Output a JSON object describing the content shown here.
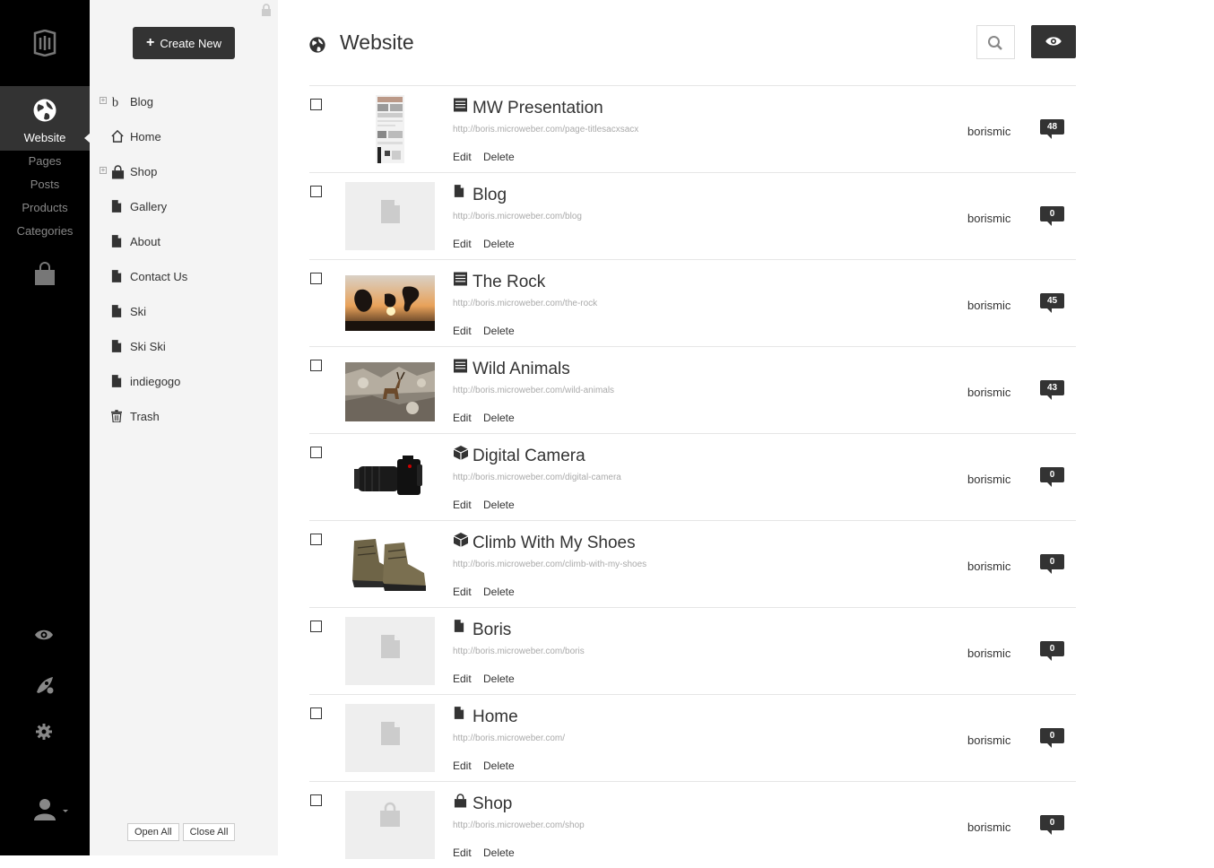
{
  "rail": {
    "active_label": "Website",
    "sub_items": [
      "Pages",
      "Posts",
      "Products",
      "Categories"
    ]
  },
  "tree": {
    "create_label": "Create New",
    "nodes": [
      {
        "label": "Blog",
        "icon": "blog-icon",
        "expandable": true
      },
      {
        "label": "Home",
        "icon": "home-icon",
        "expandable": false
      },
      {
        "label": "Shop",
        "icon": "shop-bag-icon",
        "expandable": true
      },
      {
        "label": "Gallery",
        "icon": "page-icon",
        "expandable": false
      },
      {
        "label": "About",
        "icon": "page-icon",
        "expandable": false
      },
      {
        "label": "Contact Us",
        "icon": "page-icon",
        "expandable": false
      },
      {
        "label": "Ski",
        "icon": "page-icon",
        "expandable": false
      },
      {
        "label": "Ski Ski",
        "icon": "page-icon",
        "expandable": false
      },
      {
        "label": "indiegogo",
        "icon": "page-icon",
        "expandable": false
      },
      {
        "label": "Trash",
        "icon": "trash-icon",
        "expandable": false
      }
    ],
    "open_all": "Open All",
    "close_all": "Close All"
  },
  "main": {
    "title": "Website",
    "edit_label": "Edit",
    "delete_label": "Delete",
    "rows": [
      {
        "title": "MW Presentation",
        "url": "http://boris.microweber.com/page-titlesacxsacx",
        "author": "borismic",
        "comments": "48",
        "type_icon": "post-icon",
        "thumb": "presentation"
      },
      {
        "title": "Blog",
        "url": "http://boris.microweber.com/blog",
        "author": "borismic",
        "comments": "0",
        "type_icon": "page-icon",
        "thumb": "placeholder-page"
      },
      {
        "title": "The Rock",
        "url": "http://boris.microweber.com/the-rock",
        "author": "borismic",
        "comments": "45",
        "type_icon": "post-icon",
        "thumb": "rock"
      },
      {
        "title": "Wild Animals",
        "url": "http://boris.microweber.com/wild-animals",
        "author": "borismic",
        "comments": "43",
        "type_icon": "post-icon",
        "thumb": "animals"
      },
      {
        "title": "Digital Camera",
        "url": "http://boris.microweber.com/digital-camera",
        "author": "borismic",
        "comments": "0",
        "type_icon": "product-icon",
        "thumb": "camera"
      },
      {
        "title": "Climb With My Shoes",
        "url": "http://boris.microweber.com/climb-with-my-shoes",
        "author": "borismic",
        "comments": "0",
        "type_icon": "product-icon",
        "thumb": "shoes"
      },
      {
        "title": "Boris",
        "url": "http://boris.microweber.com/boris",
        "author": "borismic",
        "comments": "0",
        "type_icon": "page-icon",
        "thumb": "placeholder-page"
      },
      {
        "title": "Home",
        "url": "http://boris.microweber.com/",
        "author": "borismic",
        "comments": "0",
        "type_icon": "page-icon",
        "thumb": "placeholder-page"
      },
      {
        "title": "Shop",
        "url": "http://boris.microweber.com/shop",
        "author": "borismic",
        "comments": "0",
        "type_icon": "shop-bag-icon",
        "thumb": "placeholder-bag"
      }
    ]
  }
}
